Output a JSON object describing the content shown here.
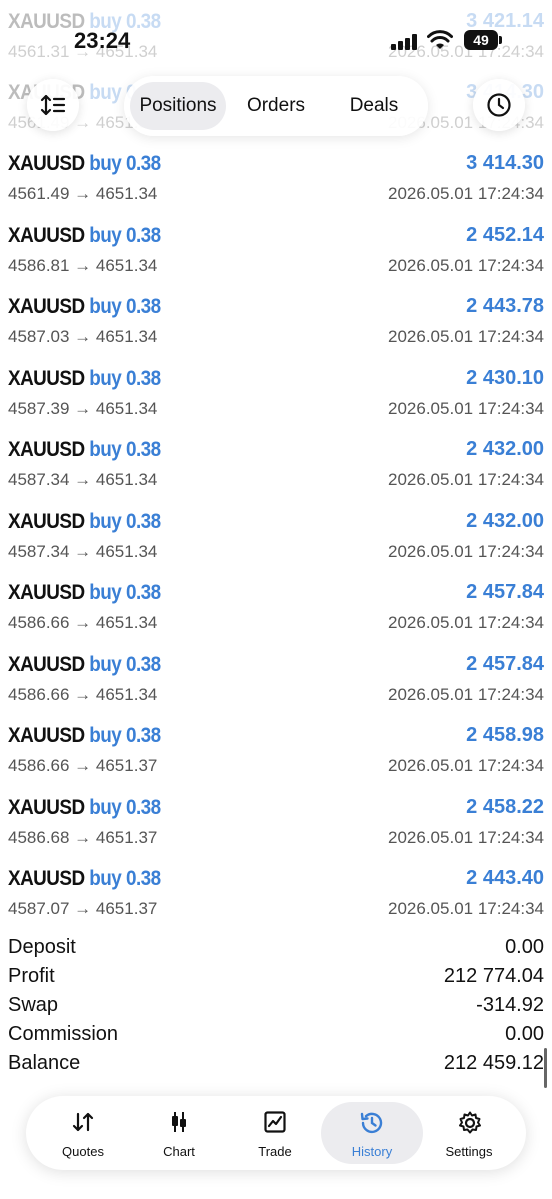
{
  "status_bar": {
    "time": "23:24",
    "battery": "49"
  },
  "top_toolbar": {
    "segments": [
      "Positions",
      "Orders",
      "Deals"
    ],
    "active_segment": "Positions",
    "sort_icon": "sort-icon",
    "history_icon": "clock-icon"
  },
  "faded_rows": [
    {
      "symbol": "XAUUSD",
      "side": "buy 0.38",
      "prices": "4561.31 → 4651.34",
      "profit": "3 421.14",
      "time": "2026.05.01 17:24:34"
    },
    {
      "symbol": "XAUUSD",
      "side": "buy 0.38",
      "prices": "4561.49 → 4651.34",
      "profit": "3 414.30",
      "time": "2026.05.01 17:24:34"
    }
  ],
  "deals": [
    {
      "symbol": "XAUUSD",
      "side": "buy 0.38",
      "prices": "4561.49 → 4651.34",
      "profit": "3 414.30",
      "time": "2026.05.01 17:24:34"
    },
    {
      "symbol": "XAUUSD",
      "side": "buy 0.38",
      "prices": "4586.81 → 4651.34",
      "profit": "2 452.14",
      "time": "2026.05.01 17:24:34"
    },
    {
      "symbol": "XAUUSD",
      "side": "buy 0.38",
      "prices": "4587.03 → 4651.34",
      "profit": "2 443.78",
      "time": "2026.05.01 17:24:34"
    },
    {
      "symbol": "XAUUSD",
      "side": "buy 0.38",
      "prices": "4587.39 → 4651.34",
      "profit": "2 430.10",
      "time": "2026.05.01 17:24:34"
    },
    {
      "symbol": "XAUUSD",
      "side": "buy 0.38",
      "prices": "4587.34 → 4651.34",
      "profit": "2 432.00",
      "time": "2026.05.01 17:24:34"
    },
    {
      "symbol": "XAUUSD",
      "side": "buy 0.38",
      "prices": "4587.34 → 4651.34",
      "profit": "2 432.00",
      "time": "2026.05.01 17:24:34"
    },
    {
      "symbol": "XAUUSD",
      "side": "buy 0.38",
      "prices": "4586.66 → 4651.34",
      "profit": "2 457.84",
      "time": "2026.05.01 17:24:34"
    },
    {
      "symbol": "XAUUSD",
      "side": "buy 0.38",
      "prices": "4586.66 → 4651.34",
      "profit": "2 457.84",
      "time": "2026.05.01 17:24:34"
    },
    {
      "symbol": "XAUUSD",
      "side": "buy 0.38",
      "prices": "4586.66 → 4651.37",
      "profit": "2 458.98",
      "time": "2026.05.01 17:24:34"
    },
    {
      "symbol": "XAUUSD",
      "side": "buy 0.38",
      "prices": "4586.68 → 4651.37",
      "profit": "2 458.22",
      "time": "2026.05.01 17:24:34"
    },
    {
      "symbol": "XAUUSD",
      "side": "buy 0.38",
      "prices": "4587.07 → 4651.37",
      "profit": "2 443.40",
      "time": "2026.05.01 17:24:34"
    }
  ],
  "summary": [
    {
      "label": "Deposit",
      "value": "0.00"
    },
    {
      "label": "Profit",
      "value": "212 774.04"
    },
    {
      "label": "Swap",
      "value": "-314.92"
    },
    {
      "label": "Commission",
      "value": "0.00"
    },
    {
      "label": "Balance",
      "value": "212 459.12"
    }
  ],
  "tab_bar": {
    "tabs": [
      {
        "label": "Quotes",
        "icon": "quotes-arrows-icon"
      },
      {
        "label": "Chart",
        "icon": "candlestick-icon"
      },
      {
        "label": "Trade",
        "icon": "trade-chart-icon"
      },
      {
        "label": "History",
        "icon": "history-clock-icon"
      },
      {
        "label": "Settings",
        "icon": "gear-icon"
      }
    ],
    "active_tab": "History"
  },
  "colors": {
    "accent": "#3a7fd5",
    "text": "#111111",
    "muted": "#555555",
    "selected_bg": "#ececef"
  }
}
